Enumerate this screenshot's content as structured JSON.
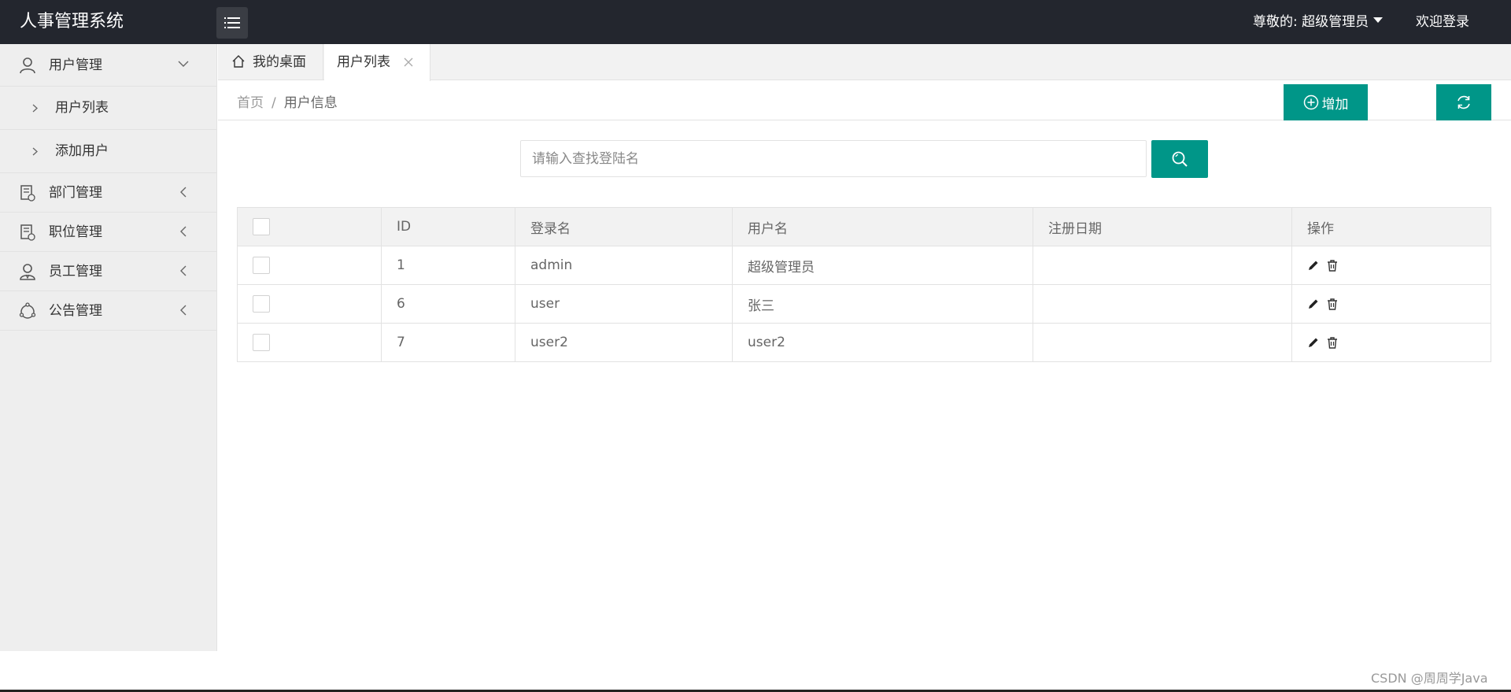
{
  "header": {
    "title": "人事管理系统",
    "user_label": "尊敬的: 超级管理员",
    "welcome": "欢迎登录"
  },
  "sidebar": {
    "items": [
      {
        "label": "用户管理",
        "icon": "user-icon",
        "expanded": true,
        "children": [
          {
            "label": "用户列表"
          },
          {
            "label": "添加用户"
          }
        ]
      },
      {
        "label": "部门管理",
        "icon": "department-icon",
        "expanded": false
      },
      {
        "label": "职位管理",
        "icon": "position-icon",
        "expanded": false
      },
      {
        "label": "员工管理",
        "icon": "employee-icon",
        "expanded": false
      },
      {
        "label": "公告管理",
        "icon": "notice-icon",
        "expanded": false
      }
    ]
  },
  "tabs": [
    {
      "label": "我的桌面",
      "icon": "home-icon",
      "active": false
    },
    {
      "label": "用户列表",
      "active": true,
      "closable": true
    }
  ],
  "breadcrumb": {
    "home": "首页",
    "separator": "/",
    "current": "用户信息"
  },
  "toolbar": {
    "add_label": "增加"
  },
  "search": {
    "placeholder": "请输入查找登陆名",
    "value": ""
  },
  "table": {
    "columns": [
      "ID",
      "登录名",
      "用户名",
      "注册日期",
      "操作"
    ],
    "rows": [
      {
        "id": "1",
        "login": "admin",
        "name": "超级管理员",
        "date": ""
      },
      {
        "id": "6",
        "login": "user",
        "name": "张三",
        "date": ""
      },
      {
        "id": "7",
        "login": "user2",
        "name": "user2",
        "date": ""
      }
    ]
  },
  "watermark": "CSDN @周周学Java",
  "colors": {
    "header_bg": "#23262e",
    "accent": "#009688",
    "sidebar_bg": "#eeeeee"
  }
}
